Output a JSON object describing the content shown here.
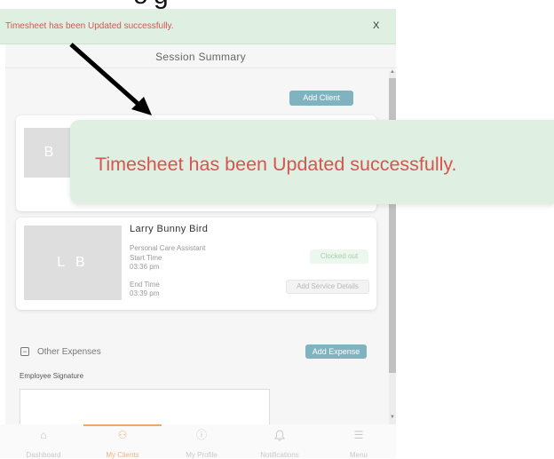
{
  "notification_small": {
    "message": "Timesheet has been Updated successfully.",
    "close_label": "X"
  },
  "notification_zoom": {
    "message": "Timesheet has been Updated successfully."
  },
  "session": {
    "title": "Session Summary",
    "add_client_label": "Add Client"
  },
  "clients": [
    {
      "initials": "B"
    },
    {
      "initials": "L B",
      "name": "Larry Bunny Bird",
      "role": "Personal Care Assistant",
      "start_label": "Start Time",
      "start_time": "03:36 pm",
      "end_label": "End Time",
      "end_time": "03:39 pm",
      "status": "Clocked out",
      "service_button": "Add Service Details"
    }
  ],
  "expenses": {
    "label": "Other Expenses",
    "add_button": "Add Expense",
    "checkbox_symbol": "−"
  },
  "signature": {
    "label": "Employee Signature"
  },
  "nav": {
    "items": [
      {
        "label": "Dashboard",
        "icon": "home-icon",
        "glyph": "⌂"
      },
      {
        "label": "My Clients",
        "icon": "clients-icon",
        "glyph": "⚇"
      },
      {
        "label": "My Profile",
        "icon": "profile-icon",
        "glyph": "ⓘ"
      },
      {
        "label": "Notifications",
        "icon": "bell-icon",
        "glyph": "♫"
      },
      {
        "label": "Menu",
        "icon": "menu-icon",
        "glyph": "☰"
      }
    ],
    "active": "My Clients"
  },
  "colors": {
    "accent_teal": "#7fb3bf",
    "toast_bg": "#dff0e3",
    "toast_text": "#d9534f",
    "nav_active": "#f0b482"
  }
}
